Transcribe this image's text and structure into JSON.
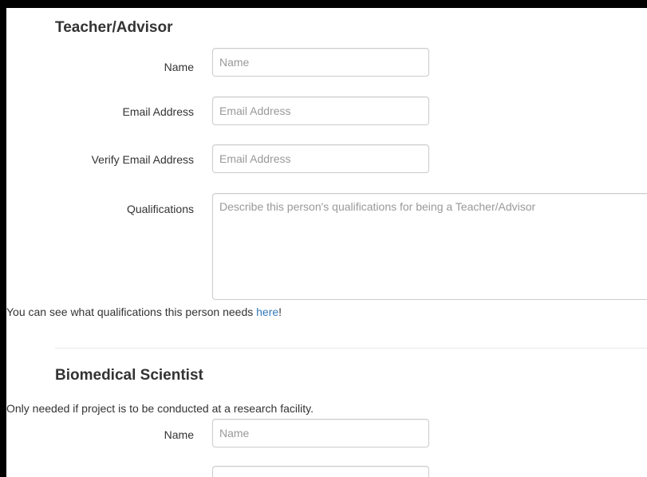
{
  "teacher_section": {
    "heading": "Teacher/Advisor",
    "name_label": "Name",
    "name_placeholder": "Name",
    "email_label": "Email Address",
    "email_placeholder": "Email Address",
    "verify_email_label": "Verify Email Address",
    "verify_email_placeholder": "Email Address",
    "qualifications_label": "Qualifications",
    "qualifications_placeholder": "Describe this person's qualifications for being a Teacher/Advisor",
    "help_text_prefix": "You can see what qualifications this person needs ",
    "help_link_text": "here",
    "help_text_suffix": "!"
  },
  "scientist_section": {
    "heading": "Biomedical Scientist",
    "note": "Only needed if project is to be conducted at a research facility.",
    "name_label": "Name",
    "name_placeholder": "Name"
  }
}
